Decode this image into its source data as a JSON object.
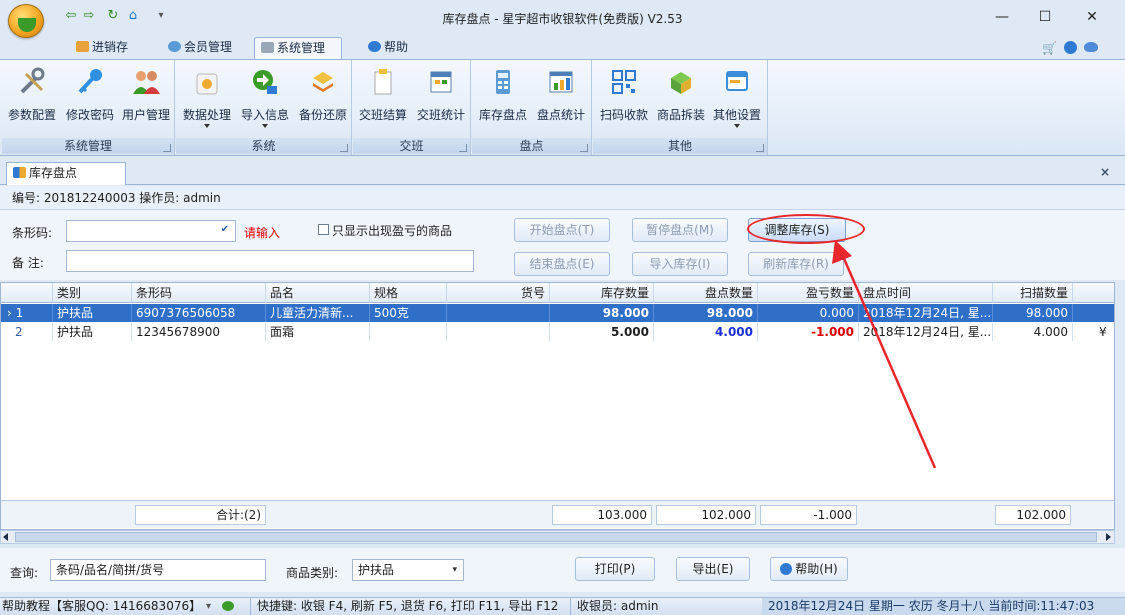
{
  "window": {
    "title": "库存盘点 - 星宇超市收银软件(免费版) V2.53",
    "controls": {
      "minimize": "—",
      "maximize": "☐",
      "close": "✕"
    }
  },
  "ribbon": {
    "tabs": [
      {
        "label": "进销存",
        "icon": "inventory-icon"
      },
      {
        "label": "会员管理",
        "icon": "member-icon"
      },
      {
        "label": "系统管理",
        "icon": "system-icon",
        "active": true
      },
      {
        "label": "帮助",
        "icon": "help-icon"
      }
    ],
    "groups": [
      {
        "label": "系统管理",
        "buttons": [
          "参数配置",
          "修改密码",
          "用户管理"
        ]
      },
      {
        "label": "系统",
        "buttons": [
          "数据处理",
          "导入信息",
          "备份还原"
        ]
      },
      {
        "label": "交班",
        "buttons": [
          "交班结算",
          "交班统计"
        ]
      },
      {
        "label": "盘点",
        "buttons": [
          "库存盘点",
          "盘点统计"
        ]
      },
      {
        "label": "其他",
        "buttons": [
          "扫码收款",
          "商品拆装",
          "其他设置"
        ]
      }
    ]
  },
  "doc_tab": {
    "label": "库存盘点",
    "close": "×"
  },
  "info": {
    "text": "编号: 201812240003   操作员: admin"
  },
  "form": {
    "barcode_label": "条形码:",
    "barcode_hint": "请输入",
    "only_loss_label": "只显示出现盈亏的商品",
    "remark_label": "备  注:",
    "buttons": {
      "start": "开始盘点(T)",
      "pause": "暂停盘点(M)",
      "adjust": "调整库存(S)",
      "end": "结束盘点(E)",
      "import": "导入库存(I)",
      "refresh": "刷新库存(R)"
    }
  },
  "grid": {
    "columns": [
      "类别",
      "条形码",
      "品名",
      "规格",
      "货号",
      "库存数量",
      "盘点数量",
      "盈亏数量",
      "盘点时间",
      "扫描数量"
    ],
    "rows": [
      {
        "index": "1",
        "category": "护扶品",
        "barcode": "6907376506058",
        "name": "儿童活力清新...",
        "spec": "500克",
        "sku": "",
        "stock": "98.000",
        "count": "98.000",
        "diff": "0.000",
        "time": "2018年12月24日, 星...",
        "scanned": "98.000",
        "selected": true
      },
      {
        "index": "2",
        "category": "护扶品",
        "barcode": "12345678900",
        "name": "面霜",
        "spec": "",
        "sku": "",
        "stock": "5.000",
        "count": "4.000",
        "diff": "-1.000",
        "time": "2018年12月24日, 星...",
        "scanned": "4.000",
        "extra": "¥"
      }
    ],
    "totals": {
      "label": "合计:(2)",
      "stock": "103.000",
      "count": "102.000",
      "diff": "-1.000",
      "scanned": "102.000"
    }
  },
  "query": {
    "label": "查询:",
    "placeholder": "条码/品名/简拼/货号",
    "category_label": "商品类别:",
    "category_value": "护扶品",
    "print": "打印(P)",
    "export": "导出(E)",
    "help": "帮助(H)"
  },
  "status": {
    "help": "帮助教程【客服QQ: 1416683076】",
    "shortcuts": "快捷键: 收银 F4, 刷新 F5, 退货 F6, 打印 F11, 导出 F12",
    "cashier": "收银员: admin",
    "datetime": "2018年12月24日 星期一 农历 冬月十八 当前时间:11:47:03"
  }
}
